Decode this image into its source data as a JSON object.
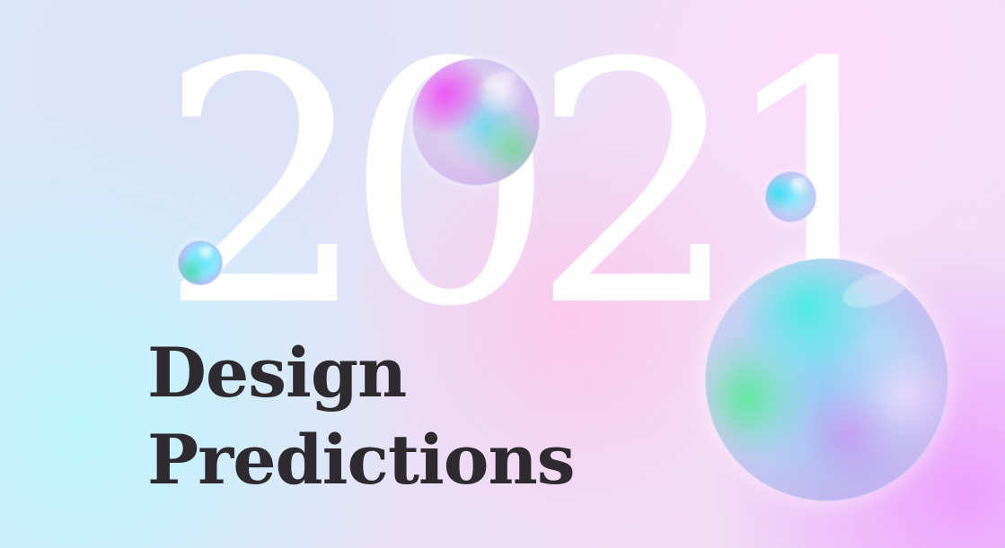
{
  "hero": {
    "year": "2021",
    "title_lines": [
      "Design",
      "Predictions"
    ]
  },
  "decor": {
    "spheres": [
      {
        "name": "top-sphere",
        "colors": [
          "#ec4bf4",
          "#56d6ee",
          "#6ae991"
        ]
      },
      {
        "name": "left-small-sphere",
        "colors": [
          "#48ddb1",
          "#6ae7ff",
          "#d6a4f3"
        ]
      },
      {
        "name": "right-small-sphere",
        "colors": [
          "#38e0f2",
          "#88efff",
          "#c8a9ef"
        ]
      },
      {
        "name": "large-sphere",
        "colors": [
          "#4bece3",
          "#60e89d",
          "#c98ff1"
        ]
      }
    ],
    "background_colors": [
      "#dbe8fb",
      "#f3def5",
      "#ec97ff"
    ]
  }
}
